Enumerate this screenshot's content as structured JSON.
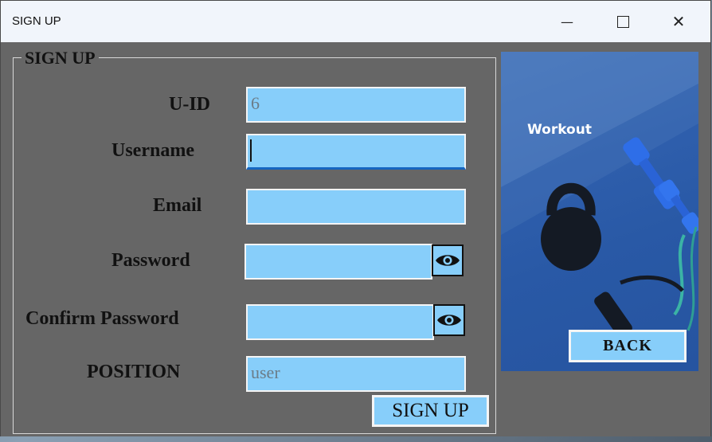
{
  "window": {
    "title": "SIGN UP",
    "controls": {
      "minimize": "—",
      "maximize": "☐",
      "close": "✕"
    }
  },
  "form": {
    "legend": "SIGN UP",
    "fields": {
      "uid": {
        "label": "U-ID",
        "value": "6"
      },
      "username": {
        "label": "Username",
        "value": ""
      },
      "email": {
        "label": "Email",
        "value": ""
      },
      "password": {
        "label": "Password",
        "value": ""
      },
      "confirm_password": {
        "label": "Confirm Password",
        "value": ""
      },
      "position": {
        "label": "POSITION",
        "value": "user"
      }
    },
    "signup_label": "SIGN UP"
  },
  "side": {
    "image_caption": "Workout",
    "back_label": "BACK"
  },
  "colors": {
    "window_bg": "#666666",
    "field_bg": "#87cefa",
    "titlebar_bg": "#f1f5fb",
    "focus_accent": "#1565c0"
  },
  "icons": {
    "password_toggle": "eye-icon",
    "confirm_password_toggle": "eye-icon"
  }
}
